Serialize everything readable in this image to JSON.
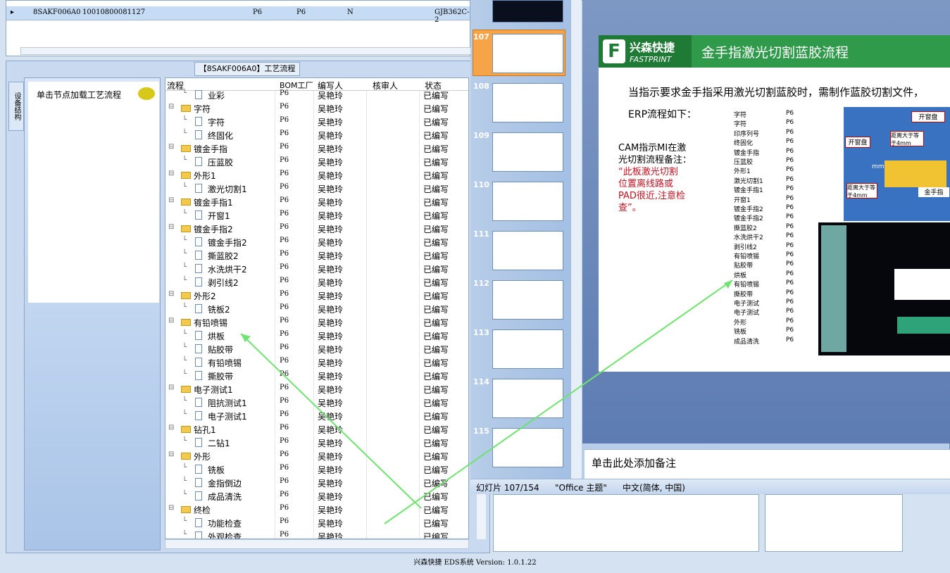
{
  "topgrid": {
    "row": {
      "c1": "8SAKF006A0",
      "c2": "10010800081127",
      "c3": "P6",
      "c4": "P6",
      "c5": "N",
      "c6": "GJB362C-2"
    }
  },
  "panel": {
    "title": "【8SAKF006A0】工艺流程",
    "vtab": "设备结构",
    "hint": "单击节点加载工艺流程"
  },
  "tree": {
    "headers": [
      "流程",
      "BOM工厂",
      "编写人",
      "核审人",
      "状态"
    ],
    "rows": [
      {
        "name": "业彩",
        "level": 2,
        "bom": "P6",
        "writer": "吴艳玲",
        "status": "已编写"
      },
      {
        "name": "字符",
        "level": 1,
        "bom": "P6",
        "writer": "吴艳玲",
        "status": "已编写"
      },
      {
        "name": "字符",
        "level": 2,
        "bom": "P6",
        "writer": "吴艳玲",
        "status": "已编写"
      },
      {
        "name": "终固化",
        "level": 2,
        "bom": "P6",
        "writer": "吴艳玲",
        "status": "已编写"
      },
      {
        "name": "镀金手指",
        "level": 1,
        "bom": "P6",
        "writer": "吴艳玲",
        "status": "已编写"
      },
      {
        "name": "压蓝胶",
        "level": 2,
        "bom": "P6",
        "writer": "吴艳玲",
        "status": "已编写"
      },
      {
        "name": "外形1",
        "level": 1,
        "bom": "P6",
        "writer": "吴艳玲",
        "status": "已编写"
      },
      {
        "name": "激光切割1",
        "level": 2,
        "bom": "P6",
        "writer": "吴艳玲",
        "status": "已编写"
      },
      {
        "name": "镀金手指1",
        "level": 1,
        "bom": "P6",
        "writer": "吴艳玲",
        "status": "已编写"
      },
      {
        "name": "开窗1",
        "level": 2,
        "bom": "P6",
        "writer": "吴艳玲",
        "status": "已编写"
      },
      {
        "name": "镀金手指2",
        "level": 1,
        "bom": "P6",
        "writer": "吴艳玲",
        "status": "已编写"
      },
      {
        "name": "镀金手指2",
        "level": 2,
        "bom": "P6",
        "writer": "吴艳玲",
        "status": "已编写"
      },
      {
        "name": "撕蓝胶2",
        "level": 2,
        "bom": "P6",
        "writer": "吴艳玲",
        "status": "已编写"
      },
      {
        "name": "水洗烘干2",
        "level": 2,
        "bom": "P6",
        "writer": "吴艳玲",
        "status": "已编写"
      },
      {
        "name": "剥引线2",
        "level": 2,
        "bom": "P6",
        "writer": "吴艳玲",
        "status": "已编写"
      },
      {
        "name": "外形2",
        "level": 1,
        "bom": "P6",
        "writer": "吴艳玲",
        "status": "已编写"
      },
      {
        "name": "铣板2",
        "level": 2,
        "bom": "P6",
        "writer": "吴艳玲",
        "status": "已编写"
      },
      {
        "name": "有铅喷锡",
        "level": 1,
        "bom": "P6",
        "writer": "吴艳玲",
        "status": "已编写"
      },
      {
        "name": "烘板",
        "level": 2,
        "bom": "P6",
        "writer": "吴艳玲",
        "status": "已编写"
      },
      {
        "name": "贴胶带",
        "level": 2,
        "bom": "P6",
        "writer": "吴艳玲",
        "status": "已编写"
      },
      {
        "name": "有铅喷锡",
        "level": 2,
        "bom": "P6",
        "writer": "吴艳玲",
        "status": "已编写"
      },
      {
        "name": "撕胶带",
        "level": 2,
        "bom": "P6",
        "writer": "吴艳玲",
        "status": "已编写"
      },
      {
        "name": "电子测试1",
        "level": 1,
        "bom": "P6",
        "writer": "吴艳玲",
        "status": "已编写"
      },
      {
        "name": "阻抗测试1",
        "level": 2,
        "bom": "P6",
        "writer": "吴艳玲",
        "status": "已编写"
      },
      {
        "name": "电子测试1",
        "level": 2,
        "bom": "P6",
        "writer": "吴艳玲",
        "status": "已编写"
      },
      {
        "name": "钻孔1",
        "level": 1,
        "bom": "P6",
        "writer": "吴艳玲",
        "status": "已编写"
      },
      {
        "name": "二钻1",
        "level": 2,
        "bom": "P6",
        "writer": "吴艳玲",
        "status": "已编写"
      },
      {
        "name": "外形",
        "level": 1,
        "bom": "P6",
        "writer": "吴艳玲",
        "status": "已编写"
      },
      {
        "name": "铣板",
        "level": 2,
        "bom": "P6",
        "writer": "吴艳玲",
        "status": "已编写"
      },
      {
        "name": "金指倒边",
        "level": 2,
        "bom": "P6",
        "writer": "吴艳玲",
        "status": "已编写"
      },
      {
        "name": "成品清洗",
        "level": 2,
        "bom": "P6",
        "writer": "吴艳玲",
        "status": "已编写"
      },
      {
        "name": "终检",
        "level": 1,
        "bom": "P6",
        "writer": "吴艳玲",
        "status": "已编写"
      },
      {
        "name": "功能检查",
        "level": 2,
        "bom": "P6",
        "writer": "吴艳玲",
        "status": "已编写"
      },
      {
        "name": "外观检查",
        "level": 2,
        "bom": "P6",
        "writer": "吴艳玲",
        "status": "已编写"
      }
    ]
  },
  "ppt": {
    "thumbs": [
      "107",
      "108",
      "109",
      "110",
      "111",
      "112",
      "113",
      "114",
      "115"
    ],
    "slide": {
      "logo_cn": "兴森快捷",
      "logo_en": "FASTPRINT",
      "logo_mark": "F",
      "title": "金手指激光切割蓝胶流程",
      "line1": "当指示要求金手指采用激光切割蓝胶时，需制作蓝胶切割文件，",
      "line2": "ERP流程如下：",
      "cam1": "CAM指示MI在激",
      "cam2": "光切割流程备注：",
      "red1": "“此板激光切割",
      "red2": "位置离线路或",
      "red3": "PAD很近,注意检",
      "red4": "查”。",
      "mini": [
        [
          "字符",
          "P6"
        ],
        [
          "字符",
          "P6"
        ],
        [
          "印序列号",
          "P6"
        ],
        [
          "终固化",
          "P6"
        ],
        [
          "镀金手指",
          "P6"
        ],
        [
          "压蓝胶",
          "P6"
        ],
        [
          "外形1",
          "P6"
        ],
        [
          "激光切割1",
          "P6"
        ],
        [
          "镀金手指1",
          "P6"
        ],
        [
          "开窗1",
          "P6"
        ],
        [
          "镀金手指2",
          "P6"
        ],
        [
          "镀金手指2",
          "P6"
        ],
        [
          "撕蓝胶2",
          "P6"
        ],
        [
          "水洗烘干2",
          "P6"
        ],
        [
          "剥引线2",
          "P6"
        ],
        [
          "有铅喷锡",
          "P6"
        ],
        [
          "贴胶带",
          "P6"
        ],
        [
          "烘板",
          "P6"
        ],
        [
          "有铅喷锡",
          "P6"
        ],
        [
          "撕胶带",
          "P6"
        ],
        [
          "电子测试",
          "P6"
        ],
        [
          "电子测试",
          "P6"
        ],
        [
          "外形",
          "P6"
        ],
        [
          "铣板",
          "P6"
        ],
        [
          "成品清洗",
          "P6"
        ]
      ],
      "img_lbl1": "开窗盘",
      "img_lbl2": "开窗盘",
      "img_lbl3": "距离大于等于4mm",
      "img_lbl4": "距离大于等于4mm",
      "img_lbl5": "金手指",
      "img_lbl6": "mm"
    },
    "notes": "单击此处添加备注",
    "status": {
      "slide": "幻灯片 107/154",
      "theme": "\"Office 主题\"",
      "lang": "中文(简体, 中国)"
    }
  },
  "footer": "兴森快捷 EDS系统 Version: 1.0.1.22"
}
